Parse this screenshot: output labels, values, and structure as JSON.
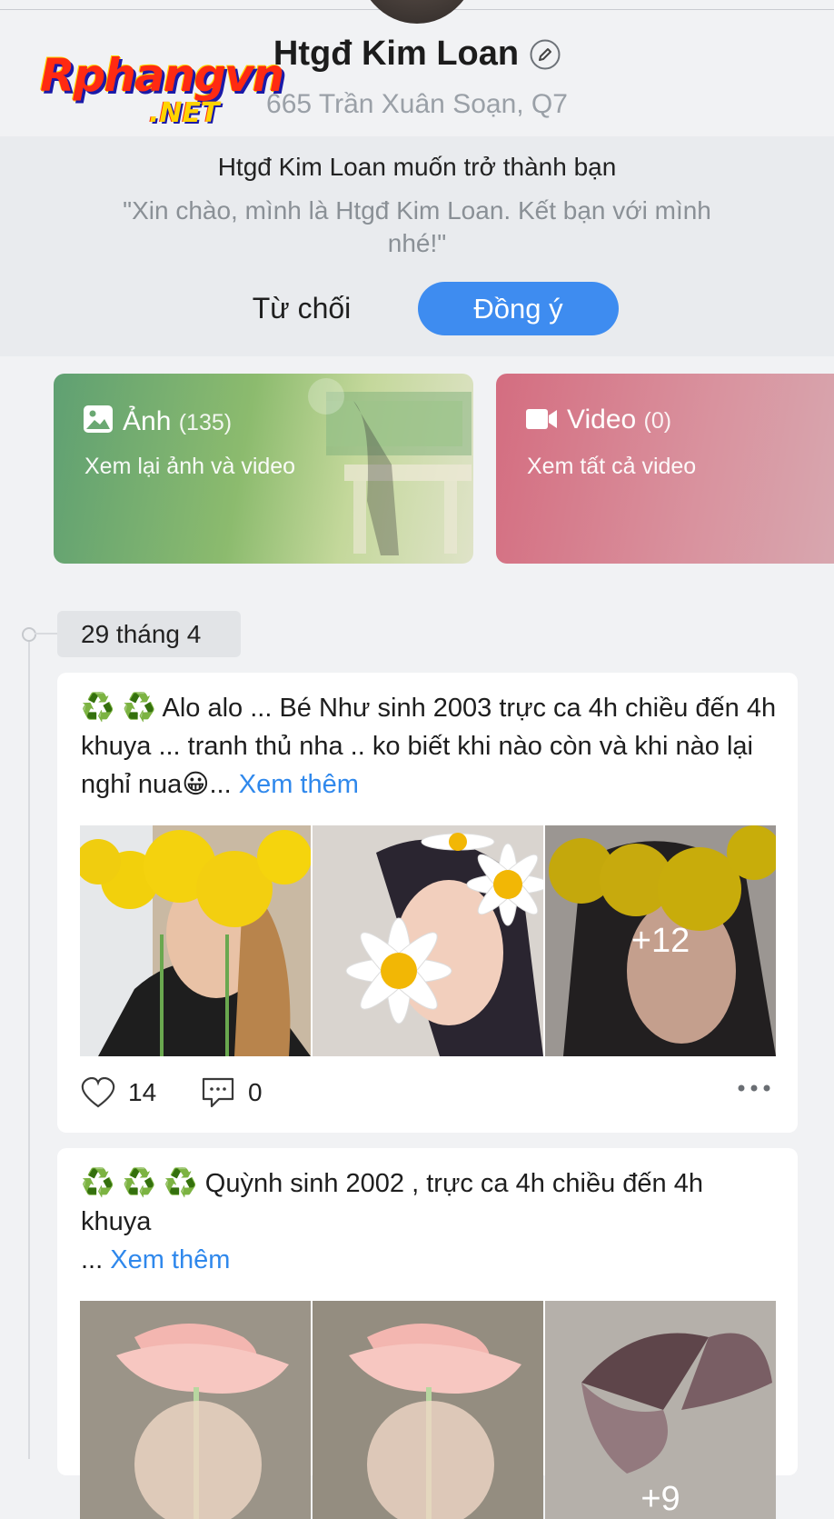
{
  "watermark": {
    "main": "Rphangvn",
    "suffix": ".NET"
  },
  "profile": {
    "name": "Htgđ Kim Loan",
    "address": "665 Trần Xuân Soạn, Q7"
  },
  "friend_request": {
    "title": "Htgđ Kim Loan muốn trở thành bạn",
    "message": "\"Xin chào, mình là Htgđ Kim Loan. Kết bạn với mình nhé!\"",
    "decline_label": "Từ chối",
    "accept_label": "Đồng ý"
  },
  "cards": {
    "photo": {
      "label": "Ảnh",
      "count": "(135)",
      "subtitle": "Xem lại ảnh và video",
      "icon": "image-icon"
    },
    "video": {
      "label": "Video",
      "count": "(0)",
      "subtitle": "Xem tất cả video",
      "icon": "video-camera-icon"
    }
  },
  "timeline": {
    "date": "29 tháng 4",
    "posts": [
      {
        "emoji_prefix": "♻️ ♻️",
        "text": " Alo alo ... Bé Như sinh 2003 trực ca 4h chiều đến 4h khuya ... tranh thủ nha .. ko biết khi nào còn và khi nào lại nghỉ nua😀... ",
        "see_more": "Xem thêm",
        "more_photos": "+12",
        "likes": "14",
        "comments": "0"
      },
      {
        "emoji_prefix": "♻️ ♻️ ♻️",
        "text": " Quỳnh sinh 2002 , trực ca 4h chiều đến 4h khuya",
        "text_line2": "... ",
        "see_more": "Xem thêm",
        "more_photos": "+9"
      }
    ]
  },
  "colors": {
    "accent": "#3e8cf0",
    "link": "#2f88ec",
    "photo_card": "#6aa872",
    "video_card": "#d47a89"
  }
}
